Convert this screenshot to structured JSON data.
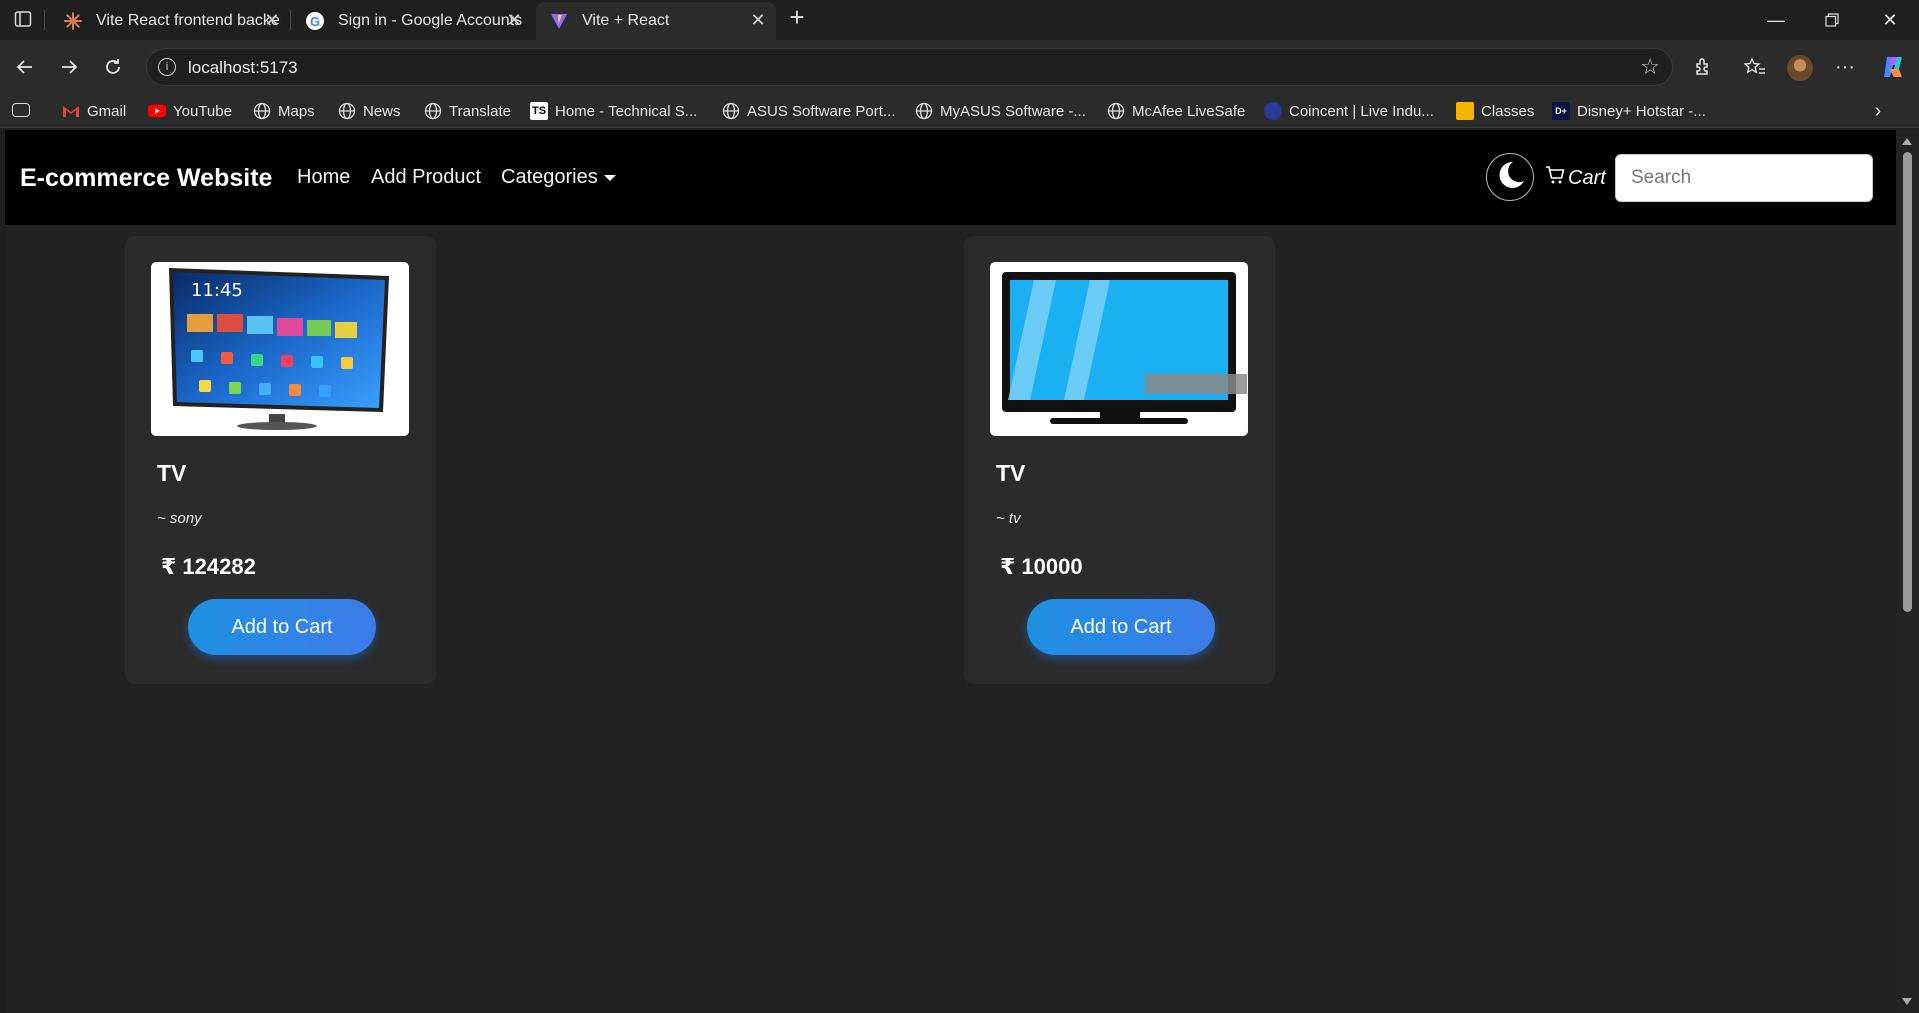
{
  "browser": {
    "tabs": [
      {
        "title": "Vite React frontend backend conn"
      },
      {
        "title": "Sign in - Google Accounts"
      },
      {
        "title": "Vite + React"
      }
    ],
    "address": "localhost:5173",
    "bookmarks": [
      {
        "label": "Gmail",
        "icon": "gmail-icon"
      },
      {
        "label": "YouTube",
        "icon": "youtube-icon"
      },
      {
        "label": "Maps",
        "icon": "globe-icon"
      },
      {
        "label": "News",
        "icon": "globe-icon"
      },
      {
        "label": "Translate",
        "icon": "globe-icon"
      },
      {
        "label": "Home - Technical S...",
        "icon": "ts-icon"
      },
      {
        "label": "ASUS Software Port...",
        "icon": "globe-icon"
      },
      {
        "label": "MyASUS Software -...",
        "icon": "globe-icon"
      },
      {
        "label": "McAfee LiveSafe",
        "icon": "globe-icon"
      },
      {
        "label": "Coincent | Live Indu...",
        "icon": "coincent-icon"
      },
      {
        "label": "Classes",
        "icon": "classroom-icon"
      },
      {
        "label": "Disney+ Hotstar -...",
        "icon": "hotstar-icon"
      }
    ]
  },
  "app": {
    "brand": "E-commerce Website",
    "nav": {
      "home": "Home",
      "add_product": "Add Product",
      "categories": "Categories"
    },
    "cart_label": "Cart",
    "search_placeholder": "Search",
    "products": [
      {
        "name": "TV",
        "brand": "~ sony",
        "price": "₹ 124282",
        "button": "Add to Cart"
      },
      {
        "name": "TV",
        "brand": "~ tv",
        "price": "₹ 10000",
        "button": "Add to Cart"
      }
    ]
  },
  "colors": {
    "accent": "#2f86e4",
    "page_bg": "#222222",
    "card_bg": "#2b2b2b",
    "navbar_bg": "#000000"
  }
}
